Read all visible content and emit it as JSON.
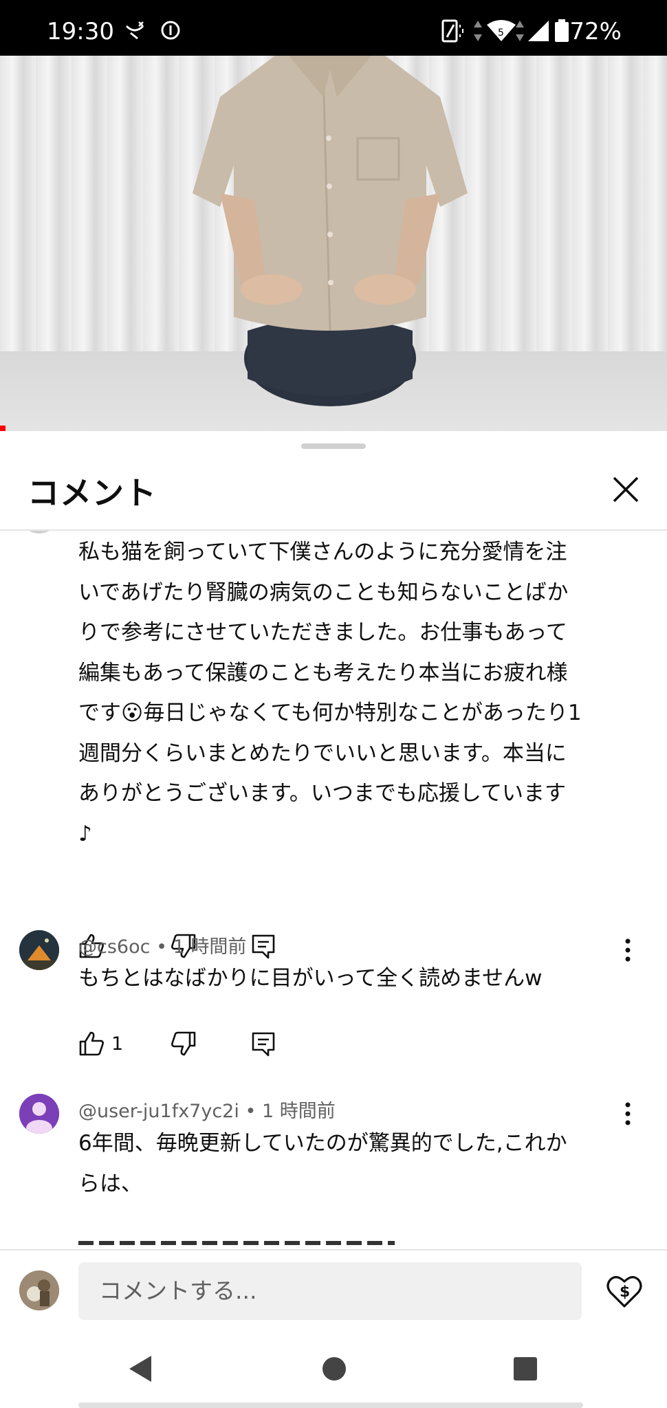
{
  "status_bar": {
    "time": "19:30",
    "battery": "72%",
    "icons": [
      "missed-call-icon",
      "info-circle-icon",
      "vibrate-icon",
      "data-arrows-icon",
      "wifi-icon",
      "signal-icon",
      "battery-icon"
    ]
  },
  "sheet": {
    "title": "コメント"
  },
  "comments": [
    {
      "text": "私も猫を飼っていて下僕さんのように充分愛情を注\nいであげたり腎臓の病気のことも知らないことばか\nりで参考にさせていただきました。お仕事もあって\n編集もあって保護のことも考えたり本当にお疲れ様\nです😮毎日じゃなくても何か特別なことがあったり1\n週間分くらいまとめたりでいいと思います。本当に\nありがとうございます。いつまでも応援しています\n♪",
      "likes": ""
    },
    {
      "author": "@cs6oc",
      "time": "1 時間前",
      "text": "もちとはなばかりに目がいって全く読めませんw",
      "likes": "1"
    },
    {
      "author": "@user-ju1fx7yc2i",
      "time": "1 時間前",
      "text": "6年間、毎晩更新していたのが驚異的でした,これか\nらは、",
      "likes": ""
    }
  ],
  "meta_separator": "•",
  "footer": {
    "input_placeholder": "コメントする..."
  }
}
